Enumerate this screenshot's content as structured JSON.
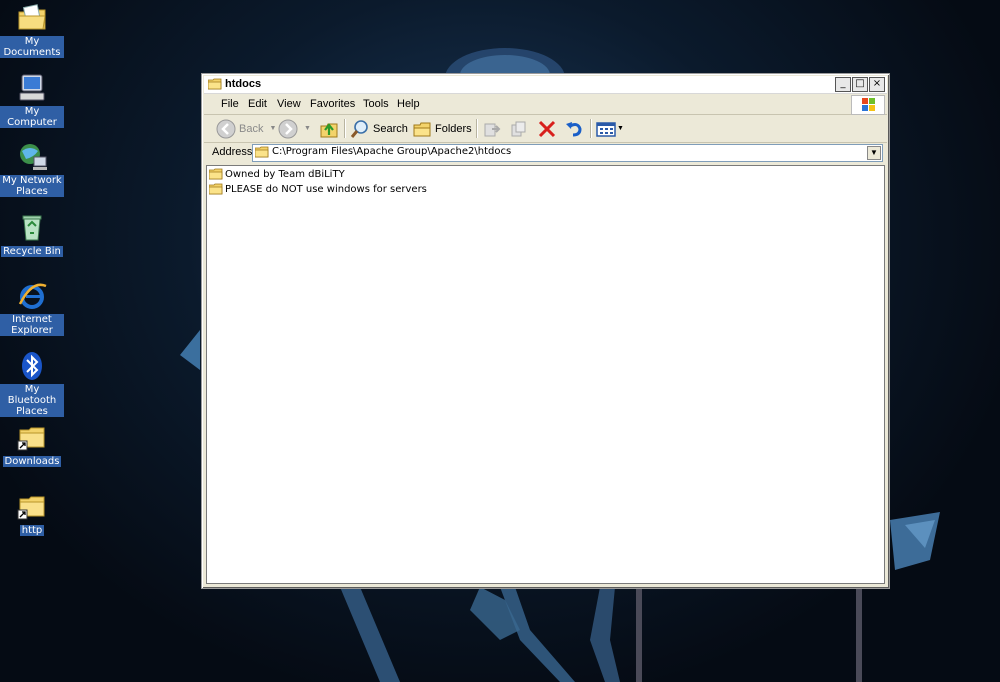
{
  "desktop": {
    "icons": [
      {
        "label": "My Documents"
      },
      {
        "label": "My Computer"
      },
      {
        "label": "My Network Places"
      },
      {
        "label": "Recycle Bin"
      },
      {
        "label": "Internet Explorer"
      },
      {
        "label": "My Bluetooth Places"
      },
      {
        "label": "Downloads"
      },
      {
        "label": "http"
      }
    ]
  },
  "window": {
    "title": "htdocs",
    "controls": {
      "minimize": "_",
      "maximize": "□",
      "close": "×"
    },
    "menu": [
      "File",
      "Edit",
      "View",
      "Favorites",
      "Tools",
      "Help"
    ],
    "toolbar": {
      "back": "Back",
      "search": "Search",
      "folders": "Folders"
    },
    "address": {
      "label": "Address",
      "value": "C:\\Program Files\\Apache Group\\Apache2\\htdocs"
    },
    "files": [
      {
        "name": "Owned by Team dBiLiTY",
        "icon": "folder-icon"
      },
      {
        "name": "PLEASE do NOT use windows for servers",
        "icon": "folder-icon"
      }
    ]
  },
  "colors": {
    "desktop_bg": "#0b1a2c",
    "label_highlight": "#2f5fa5",
    "window_face": "#ece9d8",
    "close_red": "#d8201c",
    "undo_blue": "#1a5fc8"
  }
}
